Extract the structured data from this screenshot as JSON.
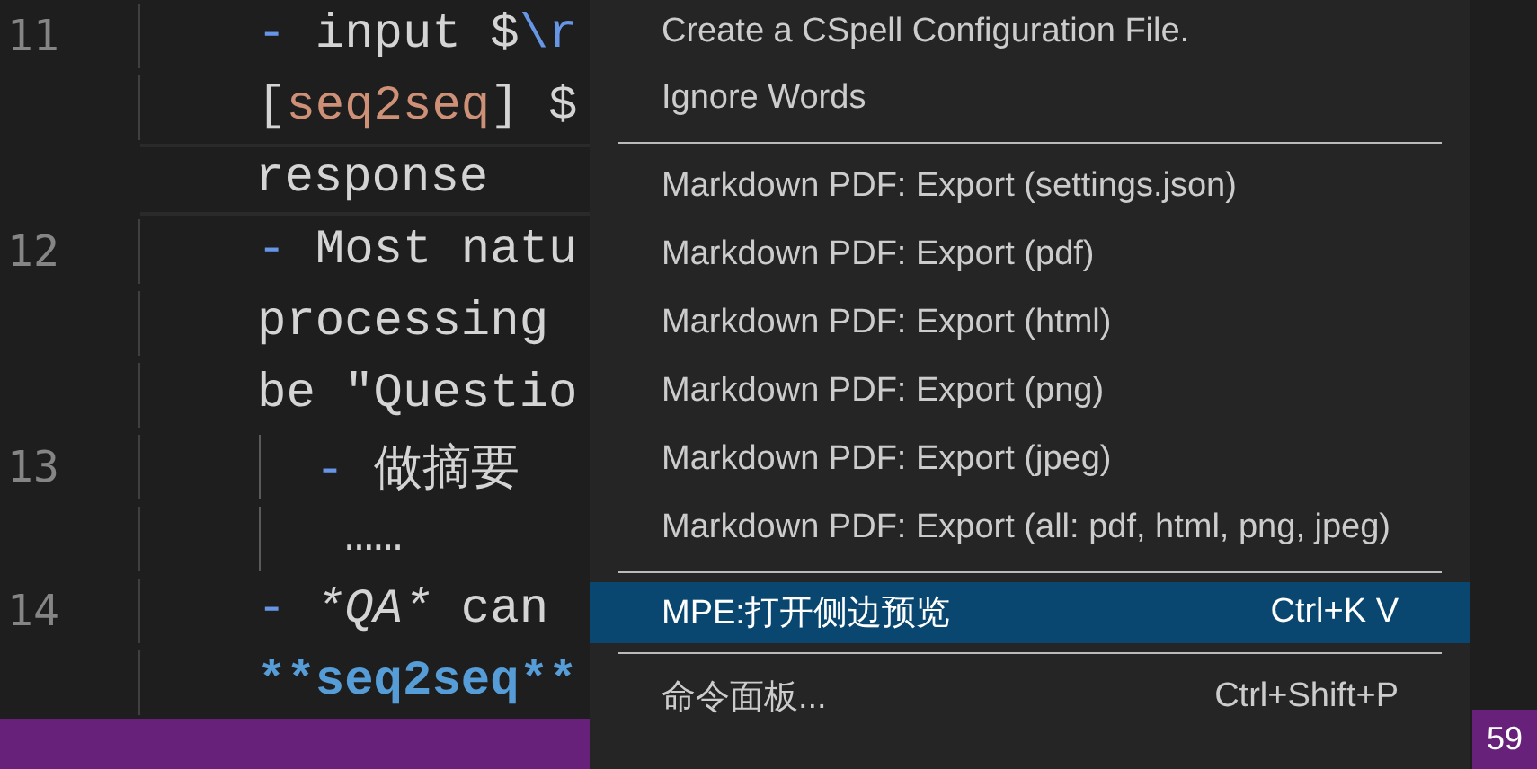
{
  "editor": {
    "lines": [
      {
        "number": "11",
        "current": false,
        "guide": false,
        "segments": [
          {
            "kind": "marker",
            "text": "- "
          },
          {
            "kind": "plain",
            "text": "input $"
          },
          {
            "kind": "escape",
            "text": "\\r"
          }
        ]
      },
      {
        "current": false,
        "guide": false,
        "segments": [
          {
            "kind": "plain",
            "text": "["
          },
          {
            "kind": "link",
            "text": "seq2seq"
          },
          {
            "kind": "plain",
            "text": "] $"
          }
        ]
      },
      {
        "current": true,
        "guide": false,
        "segments": [
          {
            "kind": "plain",
            "text": "response"
          }
        ]
      },
      {
        "number": "12",
        "current": false,
        "guide": false,
        "segments": [
          {
            "kind": "marker",
            "text": "- "
          },
          {
            "kind": "plain",
            "text": "Most natu"
          }
        ]
      },
      {
        "current": false,
        "guide": false,
        "segments": [
          {
            "kind": "plain",
            "text": "processing"
          }
        ]
      },
      {
        "current": false,
        "guide": false,
        "segments": [
          {
            "kind": "plain",
            "text": "be \"Questio"
          }
        ]
      },
      {
        "number": "13",
        "current": false,
        "guide": true,
        "segments": [
          {
            "kind": "marker",
            "text": "  - "
          },
          {
            "kind": "plain",
            "text": "做摘要"
          }
        ]
      },
      {
        "current": false,
        "guide": true,
        "segments": [
          {
            "kind": "plain",
            "text": "   ……"
          }
        ]
      },
      {
        "number": "14",
        "current": false,
        "guide": false,
        "segments": [
          {
            "kind": "marker",
            "text": "- "
          },
          {
            "kind": "italic",
            "text": "*QA*"
          },
          {
            "kind": "plain",
            "text": " can"
          }
        ]
      },
      {
        "current": false,
        "guide": false,
        "segments": [
          {
            "kind": "bold",
            "text": "**seq2seq**"
          }
        ]
      }
    ]
  },
  "context_menu": {
    "items": [
      {
        "kind": "item",
        "label": "Create a CSpell Configuration File.",
        "selected": false
      },
      {
        "kind": "item",
        "label": "Ignore Words",
        "selected": false
      },
      {
        "kind": "separator"
      },
      {
        "kind": "item",
        "label": "Markdown PDF: Export (settings.json)",
        "selected": false
      },
      {
        "kind": "item",
        "label": "Markdown PDF: Export (pdf)",
        "selected": false
      },
      {
        "kind": "item",
        "label": "Markdown PDF: Export (html)",
        "selected": false
      },
      {
        "kind": "item",
        "label": "Markdown PDF: Export (png)",
        "selected": false
      },
      {
        "kind": "item",
        "label": "Markdown PDF: Export (jpeg)",
        "selected": false
      },
      {
        "kind": "item",
        "label": "Markdown PDF: Export (all: pdf, html, png, jpeg)",
        "selected": false
      },
      {
        "kind": "separator"
      },
      {
        "kind": "item",
        "label": "MPE:打开侧边预览",
        "shortcut": "Ctrl+K V",
        "selected": true
      },
      {
        "kind": "separator"
      },
      {
        "kind": "item",
        "label": "命令面板...",
        "shortcut": "Ctrl+Shift+P",
        "selected": false
      }
    ]
  },
  "status_bar": {
    "badge": "59"
  }
}
